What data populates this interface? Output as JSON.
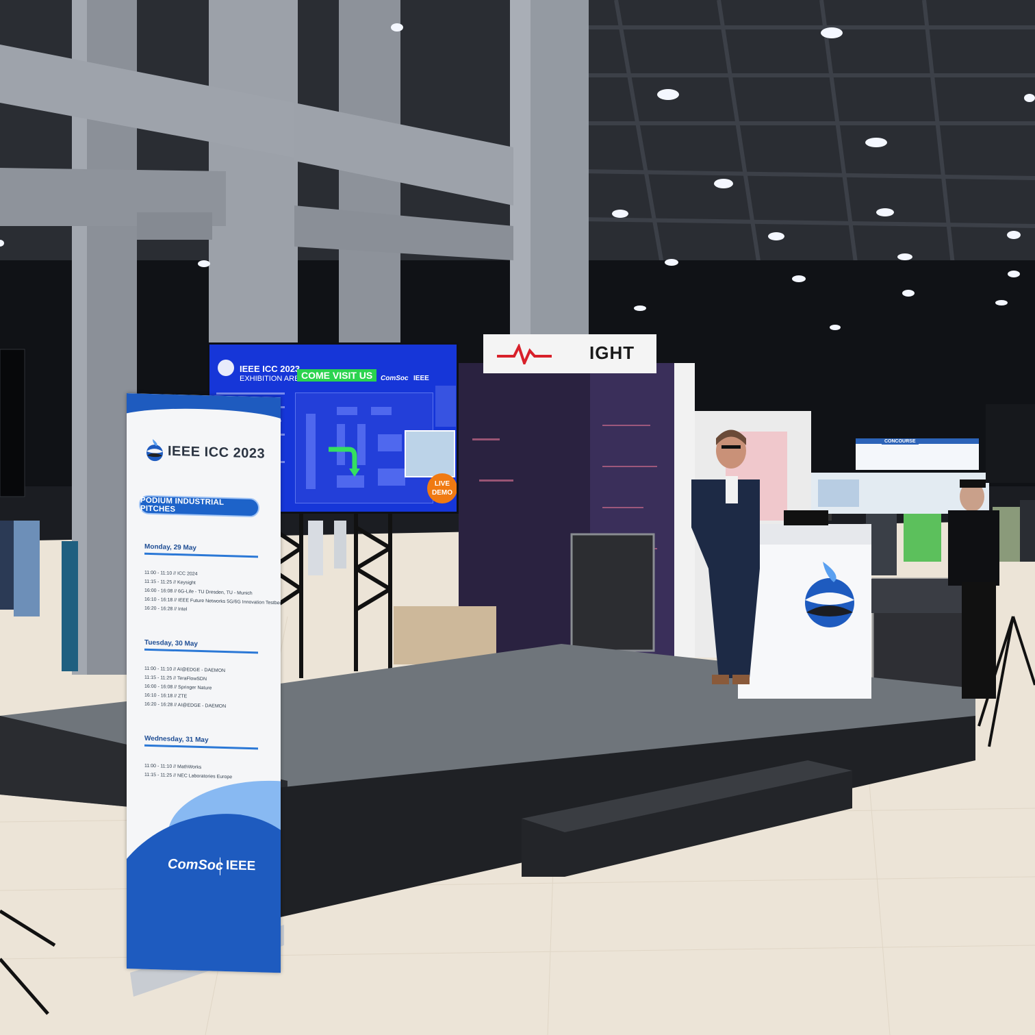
{
  "banner": {
    "title": "IEEE ICC 2023",
    "pill": "PODIUM INDUSTRIAL PITCHES",
    "days": [
      {
        "label": "Monday, 29 May",
        "slots": [
          "11:00 - 11:10 // ICC 2024",
          "11:15 - 11:25 // Keysight",
          "16:00 - 16:08 // 6G-Life - TU Dresden, TU - Munich",
          "16:10 - 16:18 // IEEE Future Networks 5G/6G Innovation Testbed",
          "16:20 - 16:28 // Intel"
        ]
      },
      {
        "label": "Tuesday, 30 May",
        "slots": [
          "11:00 - 11:10 // AI@EDGE - DAEMON",
          "11:15 - 11:25 // TeraFlowSDN",
          "16:00 - 16:08 // Springer Nature",
          "16:10 - 16:18 // ZTE",
          "16:20 - 16:28 // AI@EDGE - DAEMON"
        ]
      },
      {
        "label": "Wednesday, 31 May",
        "slots": [
          "11:00 - 11:10 // MathWorks",
          "11:15 - 11:25 // NEC Laboratories Europe"
        ]
      }
    ],
    "footer_left": "ComSoc",
    "footer_right": "IEEE"
  },
  "screen": {
    "title": "IEEE ICC 2023",
    "subtitle": "EXHIBITION AREA",
    "cta": "COME VISIT US",
    "brand_left": "ComSoc",
    "brand_right": "IEEE",
    "badge": "LIVE DEMO"
  },
  "booth_sign": "IGHT",
  "concourse_sign": "CONCOURSE",
  "colors": {
    "ieee_blue": "#1e5bbf",
    "screen_blue": "#1636d8",
    "cta_green": "#2bd34f",
    "demo_orange": "#f07a12",
    "stage_grey": "#6c7278"
  }
}
